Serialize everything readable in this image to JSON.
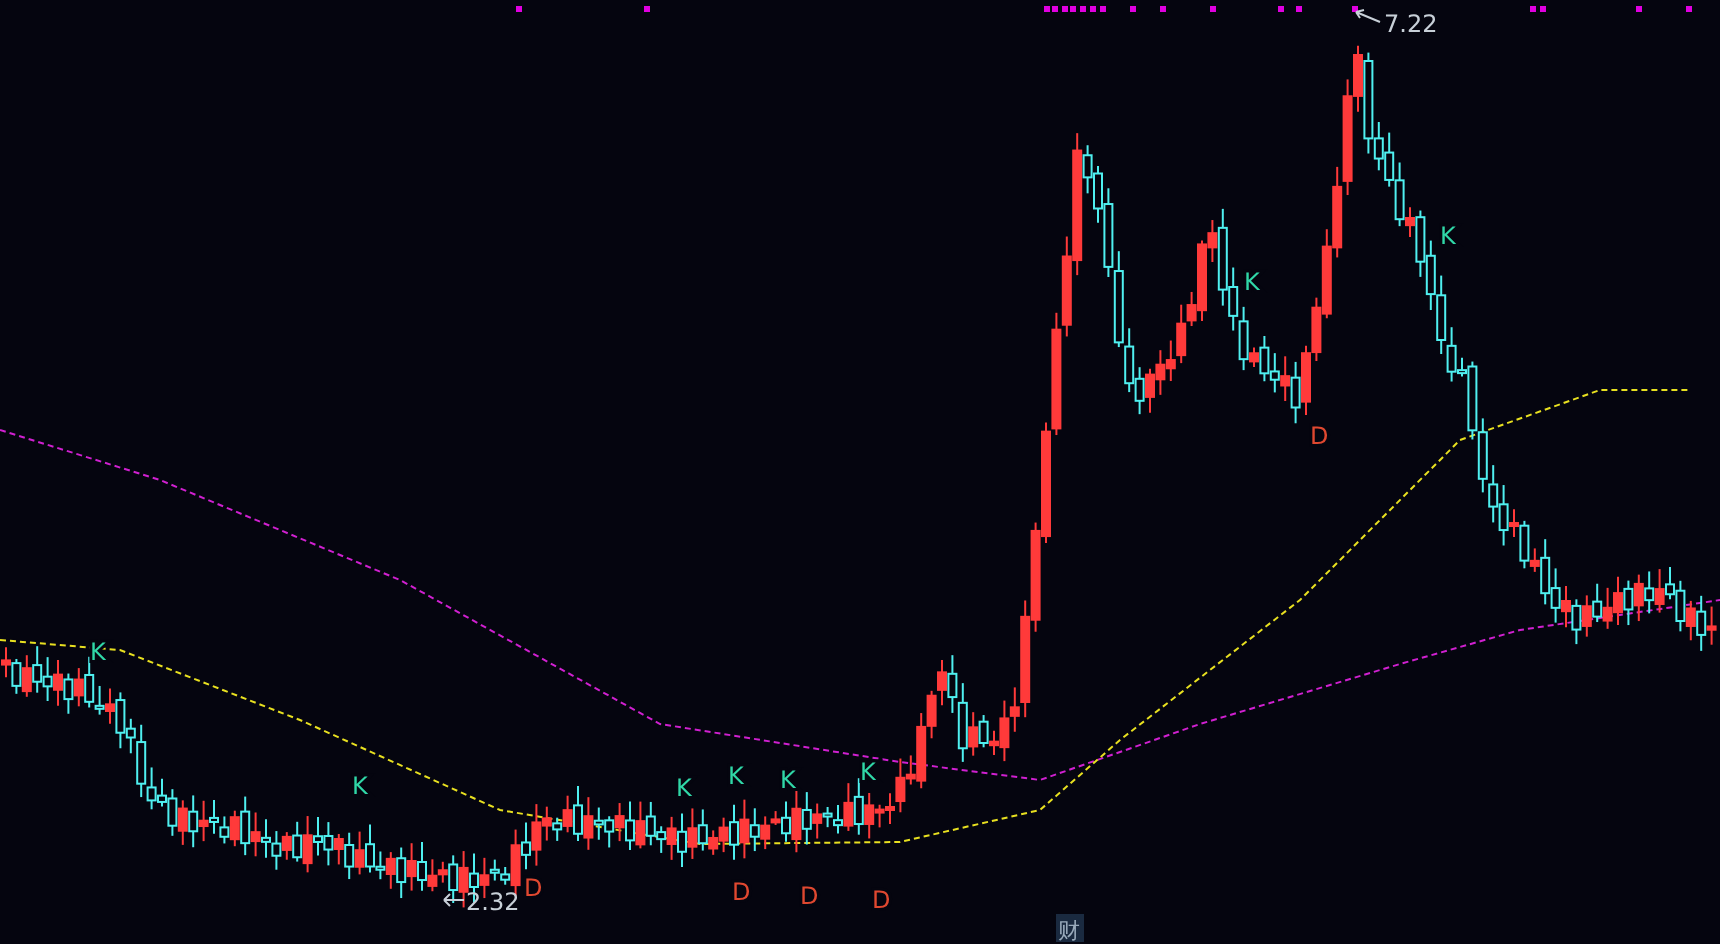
{
  "chart": {
    "high_label": "7.22",
    "low_label": "2.32",
    "badge": "财",
    "markers": [
      {
        "text": "K",
        "kind": "k"
      },
      {
        "text": "K",
        "kind": "k"
      },
      {
        "text": "D",
        "kind": "d"
      },
      {
        "text": "K",
        "kind": "k"
      },
      {
        "text": "K",
        "kind": "k"
      },
      {
        "text": "D",
        "kind": "d"
      },
      {
        "text": "K",
        "kind": "k"
      },
      {
        "text": "D",
        "kind": "d"
      },
      {
        "text": "K",
        "kind": "k"
      },
      {
        "text": "D",
        "kind": "d"
      },
      {
        "text": "K",
        "kind": "k"
      },
      {
        "text": "D",
        "kind": "d"
      },
      {
        "text": "K",
        "kind": "k"
      }
    ]
  }
}
